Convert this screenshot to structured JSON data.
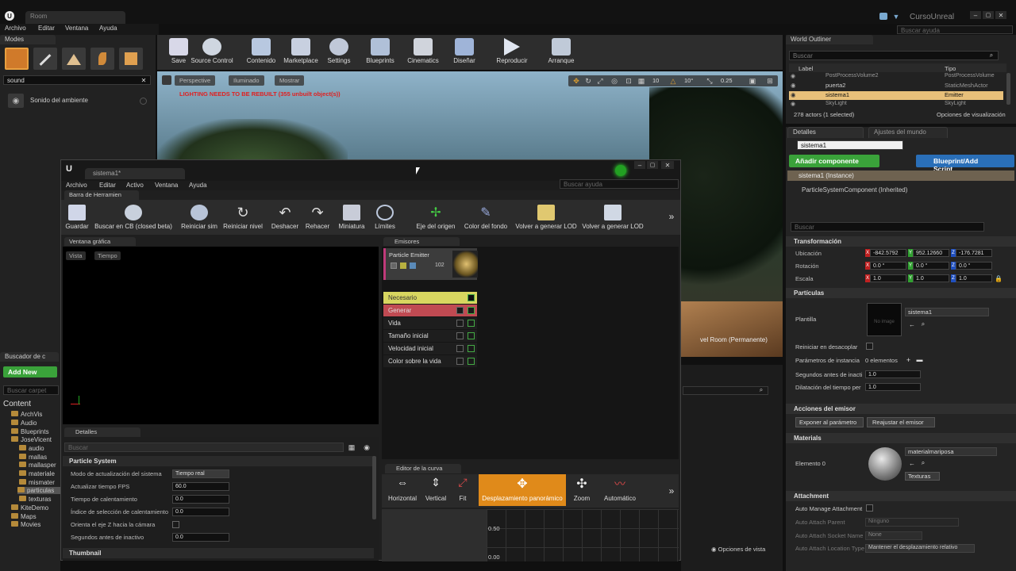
{
  "titlebar": {
    "tab_room": "Room",
    "project": "CursoUnreal",
    "help_search_placeholder": "Buscar ayuda"
  },
  "menu": [
    "Archivo",
    "Editar",
    "Ventana",
    "Ayuda"
  ],
  "modes": {
    "title": "Modes",
    "search_value": "sound",
    "result_label": "Sonido del ambiente"
  },
  "toolbar": {
    "buttons": [
      "Save",
      "Source Control",
      "Contenido",
      "Marketplace",
      "Settings",
      "Blueprints",
      "Cinematics",
      "Diseñar",
      "Reproducir",
      "Arranque"
    ]
  },
  "viewport": {
    "perspective": "Perspective",
    "lit": "Iluminado",
    "show": "Mostrar",
    "warning": "LIGHTING NEEDS TO BE REBUILT (355 unbuilt object(s))",
    "grid_value": "10",
    "angle_value": "10°",
    "scale_value": "0.25",
    "level_label": "vel  Room (Permanente)"
  },
  "outliner": {
    "title": "World Outliner",
    "search_placeholder": "Buscar",
    "col_label": "Label",
    "col_type": "Tipo",
    "rows": [
      {
        "label": "PostProcessVolume2",
        "type": "PostProcessVolume"
      },
      {
        "label": "puerta2",
        "type": "StaticMeshActor"
      },
      {
        "label": "sistema1",
        "type": "Emitter"
      },
      {
        "label": "SkyLight",
        "type": "SkyLight"
      }
    ],
    "count": "278 actors (1 selected)",
    "view_options": "Opciones de visualización"
  },
  "details": {
    "tab_details": "Detalles",
    "tab_world": "Ajustes del mundo",
    "name_value": "sistema1",
    "add_component": "Añadir componente",
    "blueprint_script": "Blueprint/Add Script",
    "instance": "sistema1 (Instance)",
    "component": "ParticleSystemComponent (Inherited)",
    "search_placeholder": "Buscar",
    "transform": {
      "title": "Transformación",
      "location": "Ubicación",
      "rotation": "Rotación",
      "scale": "Escala",
      "loc_values": [
        "-842.5792",
        "952.12660",
        "-176.7281"
      ],
      "rot_values": [
        "0.0 °",
        "0.0 °",
        "0.0 °"
      ],
      "scale_values": [
        "1.0",
        "1.0",
        "1.0"
      ]
    },
    "particles": {
      "title": "Partículas",
      "template_label": "Plantilla",
      "template_value": "sistema1",
      "thumb_text": "No image",
      "reset_label": "Reiniciar en desacoplar",
      "params_label": "Parámetros de instancia",
      "params_value": "0 elementos",
      "inactive_label": "Segundos antes de inacti",
      "inactive_value": "1.0",
      "dilation_label": "Dilatación del tiempo per",
      "dilation_value": "1.0"
    },
    "emitter_actions": {
      "title": "Acciones del emisor",
      "expose": "Exponer al parámetro",
      "reset": "Reajustar el emisor"
    },
    "materials": {
      "title": "Materials",
      "element": "Elemento 0",
      "value": "materialmariposa",
      "textures": "Texturas"
    },
    "attachment": {
      "title": "Attachment",
      "auto_manage": "Auto Manage Attachment",
      "parent_label": "Auto Attach Parent",
      "parent_value": "Ninguno",
      "socket_label": "Auto Attach Socket Name",
      "socket_value": "None",
      "location_label": "Auto Attach Location Type",
      "location_value": "Mantener el desplazamiento relativo"
    }
  },
  "cascade": {
    "tab_title": "sistema1*",
    "menu": [
      "Archivo",
      "Editar",
      "Activo",
      "Ventana",
      "Ayuda"
    ],
    "help_placeholder": "Buscar ayuda",
    "toolbar_tab": "Barra de Herramien",
    "buttons": [
      "Guardar",
      "Buscar en CB (closed beta)",
      "Reiniciar sim",
      "Reiniciar nivel",
      "Deshacer",
      "Rehacer",
      "Miniatura",
      "Límites",
      "Eje del origen",
      "Color del fondo",
      "Volver a generar LOD",
      "Volver a generar LOD"
    ],
    "viewport_tab": "Ventana gráfica",
    "view_btn": "Vista",
    "time_btn": "Tiempo",
    "emitters_tab": "Emisores",
    "emitter_name": "Particle Emitter",
    "emitter_count": "102",
    "modules": [
      "Necesario",
      "Generar",
      "Vida",
      "Tamaño inicial",
      "Velocidad inicial",
      "Color sobre la vida"
    ],
    "details_tab": "Detalles",
    "details_search": "Buscar",
    "section_particle": "Particle System",
    "props": [
      {
        "label": "Modo de actualización del sistema",
        "value": "Tiempo real"
      },
      {
        "label": "Actualizar tiempo FPS",
        "value": "60.0"
      },
      {
        "label": "Tiempo de calentamiento",
        "value": "0.0"
      },
      {
        "label": "Índice de selección de calentamiento",
        "value": "0.0"
      },
      {
        "label": "Orienta el eje Z hacia la cámara",
        "value": ""
      },
      {
        "label": "Segundos antes de inactivo",
        "value": "0.0"
      }
    ],
    "section_thumb": "Thumbnail",
    "curve_tab": "Editor de la curva",
    "curve_buttons": [
      "Horizontal",
      "Vertical",
      "Fit",
      "Desplazamiento panorámico",
      "Zoom",
      "Automático"
    ],
    "curve_y1": "0.50",
    "curve_y2": "0.00",
    "view_options": "Opciones de vista"
  },
  "cbrowser": {
    "title": "Buscador de c",
    "add_new": "Add New",
    "search_placeholder": "Buscar carpet",
    "root": "Content",
    "items": [
      "ArchVis",
      "Audio",
      "Blueprints",
      "JoseVicent",
      "audio",
      "mallas",
      "mallasper",
      "materiale",
      "mismater",
      "particulas",
      "texturas",
      "KiteDemo",
      "Maps",
      "Movies"
    ]
  }
}
